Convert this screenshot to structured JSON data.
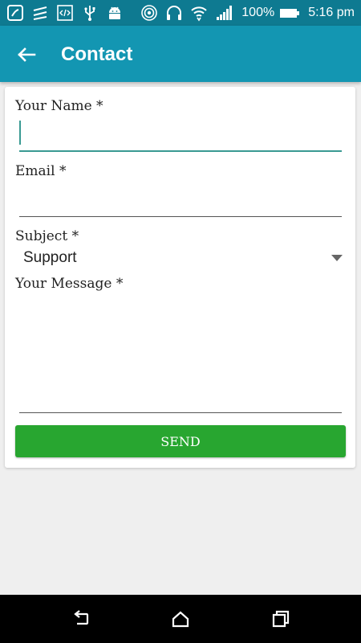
{
  "status_bar": {
    "battery_percent": "100%",
    "time": "5:16 pm",
    "left_icons": [
      "saavn-icon",
      "zedge-icon",
      "code-icon",
      "usb-icon",
      "android-icon"
    ],
    "right_icons": [
      "hotspot-icon",
      "headphones-icon",
      "wifi-icon",
      "signal-icon",
      "battery-icon"
    ]
  },
  "toolbar": {
    "title": "Contact"
  },
  "form": {
    "name_label": "Your Name *",
    "name_value": "",
    "email_label": "Email *",
    "email_value": "",
    "subject_label": "Subject *",
    "subject_value": "Support",
    "message_label": "Your Message *",
    "message_value": "",
    "send_label": "SEND"
  },
  "nav_bar": {
    "icons": [
      "back-nav-icon",
      "home-nav-icon",
      "recents-nav-icon"
    ]
  },
  "colors": {
    "status_bar": "#0e7a91",
    "toolbar": "#1396b2",
    "accent": "#3a9a93",
    "send_button": "#28a630",
    "background": "#efefef"
  }
}
